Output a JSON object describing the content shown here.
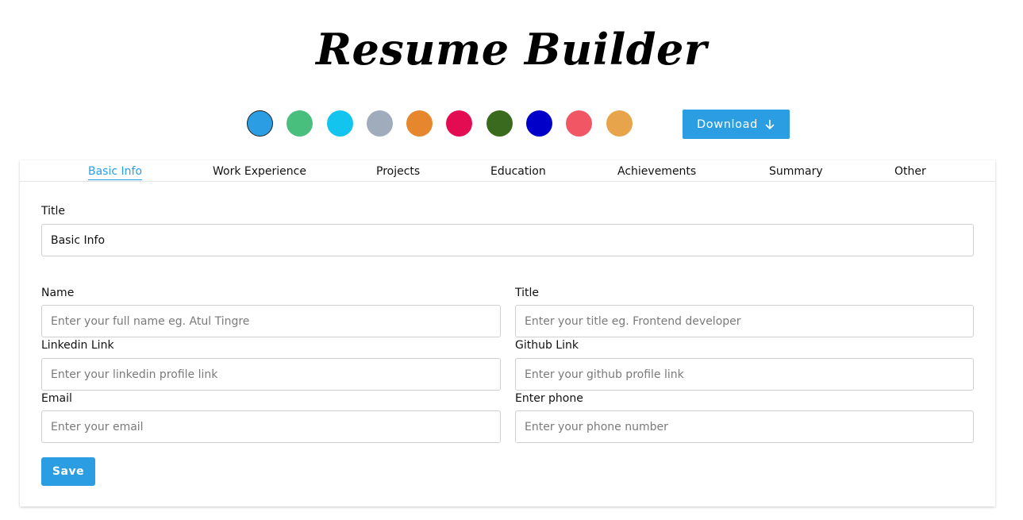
{
  "app": {
    "title": "Resume Builder"
  },
  "theme": {
    "swatches": [
      "#2b9de3",
      "#49bf7e",
      "#12c4ee",
      "#a0acbc",
      "#e6862d",
      "#e30c52",
      "#3a6a1e",
      "#0000c8",
      "#f15664",
      "#e8a44a"
    ],
    "active_swatch": "#2b9de3"
  },
  "toolbar": {
    "download_label": "Download"
  },
  "tabs": [
    {
      "label": "Basic Info",
      "active": true
    },
    {
      "label": "Work Experience",
      "active": false
    },
    {
      "label": "Projects",
      "active": false
    },
    {
      "label": "Education",
      "active": false
    },
    {
      "label": "Achievements",
      "active": false
    },
    {
      "label": "Summary",
      "active": false
    },
    {
      "label": "Other",
      "active": false
    }
  ],
  "form": {
    "section_title_label": "Title",
    "section_title_value": "Basic Info",
    "name": {
      "label": "Name",
      "placeholder": "Enter your full name eg. Atul Tingre"
    },
    "title": {
      "label": "Title",
      "placeholder": "Enter your title eg. Frontend developer"
    },
    "linkedin": {
      "label": "Linkedin Link",
      "placeholder": "Enter your linkedin profile link"
    },
    "github": {
      "label": "Github Link",
      "placeholder": "Enter your github profile link"
    },
    "email": {
      "label": "Email",
      "placeholder": "Enter your email"
    },
    "phone": {
      "label": "Enter phone",
      "placeholder": "Enter your phone number"
    },
    "save_label": "Save"
  }
}
